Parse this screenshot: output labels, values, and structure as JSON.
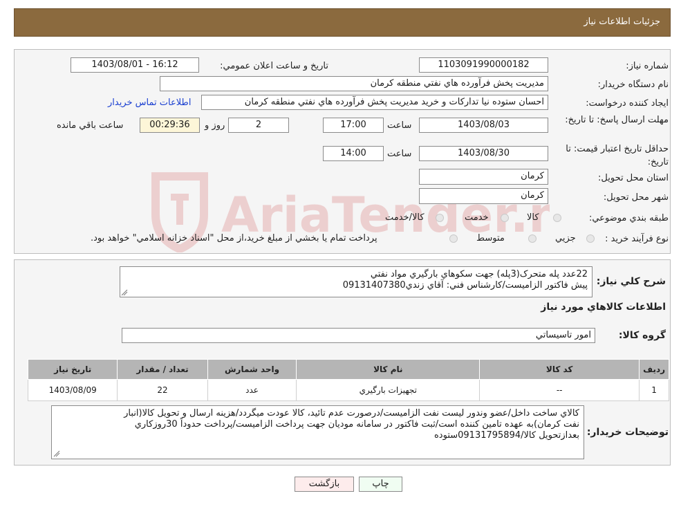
{
  "header": {
    "title": "جزئيات اطلاعات نياز"
  },
  "form": {
    "need_number_label": "شماره نياز:",
    "need_number": "1103091990000182",
    "announce_label": "تاريخ و ساعت اعلان عمومي:",
    "announce_value": "1403/08/01 - 16:12",
    "buyer_org_label": "نام دستگاه خريدار:",
    "buyer_org": "مديريت پخش فرآورده هاي نفتي منطقه کرمان",
    "creator_label": "ايجاد کننده درخواست:",
    "creator": "احسان  ستوده نيا  تدارکات و خريد  مديريت پخش فرآورده هاي نفتي منطقه کرمان",
    "contact_link": "اطلاعات تماس خريدار",
    "deadline_label": "مهلت ارسال پاسخ: تا تاريخ:",
    "deadline_date": "1403/08/03",
    "time_label": "ساعت",
    "deadline_time": "17:00",
    "days_value": "2",
    "days_label": "روز و",
    "remaining_value": "00:29:36",
    "remaining_label": "ساعت باقي مانده",
    "validity_label": "حداقل تاريخ اعتبار قيمت: تا تاريخ:",
    "validity_date": "1403/08/30",
    "validity_time": "14:00",
    "province_label": "استان محل تحويل:",
    "province": "کرمان",
    "city_label": "شهر محل تحويل:",
    "city": "کرمان",
    "category_label": "طبقه بندي موضوعي:",
    "category_options": [
      "کالا",
      "خدمت",
      "کالا/خدمت"
    ],
    "process_label": "نوع فرآيند خريد :",
    "process_options": [
      "جزيي",
      "متوسط"
    ],
    "process_note": "پرداخت تمام يا بخشي از مبلغ خريد،از محل \"اسناد خزانه اسلامي\" خواهد بود."
  },
  "description": {
    "label": "شرح کلي نياز:",
    "line1": "22عدد پله متحرک(3پله) جهت سکوهاي بارگيري مواد نفتي",
    "line2": "پيش فاکتور الزاميست/کارشناس فني: آقاي زندي09131407380"
  },
  "goods": {
    "title": "اطلاعات کالاهاي مورد نياز",
    "group_label": "گروه کالا:",
    "group_value": "امور تاسيساتي",
    "columns": [
      "رديف",
      "کد کالا",
      "نام کالا",
      "واحد شمارش",
      "تعداد / مقدار",
      "تاريخ نياز"
    ],
    "rows": [
      {
        "row": "1",
        "code": "--",
        "name": "تجهيزات بارگيري",
        "unit": "عدد",
        "qty": "22",
        "date": "1403/08/09"
      }
    ]
  },
  "buyer_notes": {
    "label": "توضيحات خريدار:",
    "line1": "کالاي ساخت داخل/عضو وندور ليست نفت الزاميست/درصورت عدم تائيد، کالا عودت ميگردد/هزينه ارسال و تحويل کالا(انبار",
    "line2": "نفت کرمان)به عهده تامين کننده است/ثبت فاکتور در سامانه موديان جهت پرداخت الزاميست/پرداخت حدوداً 30روزکاري",
    "line3": "بعدازتحويل کالا/09131795894ستوده"
  },
  "buttons": {
    "print": "چاپ",
    "back": "بازگشت"
  },
  "watermark": {
    "text": "AriaTender.neT"
  }
}
